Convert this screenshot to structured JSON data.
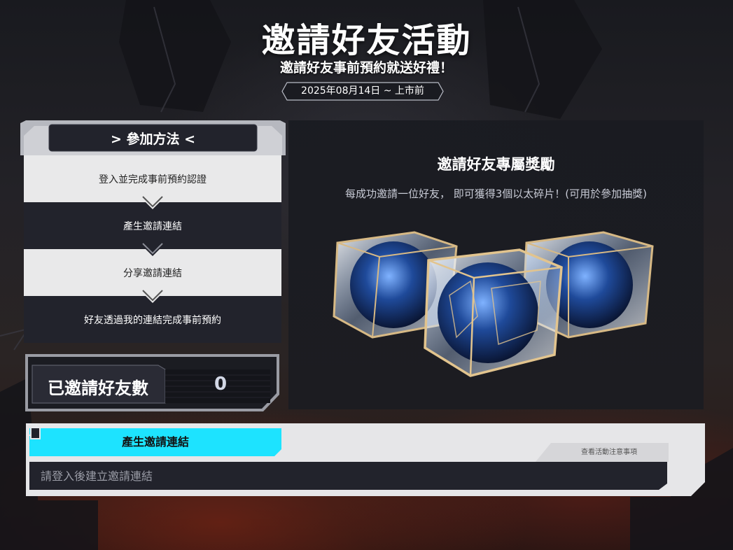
{
  "header": {
    "title": "邀請好友活動",
    "subtitle": "邀請好友事前預約就送好禮！",
    "date": "2025年08月14日 ~ 上市前"
  },
  "steps": {
    "title": "參加方法",
    "items": [
      {
        "label": "登入並完成事前預約認證"
      },
      {
        "label": "產生邀請連結"
      },
      {
        "label": "分享邀請連結"
      },
      {
        "label": "好友透過我的連結完成事前預約"
      }
    ]
  },
  "invite_count": {
    "label": "已邀請好友數",
    "value": "0"
  },
  "reward": {
    "title": "邀請好友專屬獎勵",
    "description": "每成功邀請一位好友， 即可獲得3個以太碎片！(可用於參加抽獎)",
    "item_icon": "ether-shard-cube-icon"
  },
  "link_section": {
    "generate_button": "產生邀請連結",
    "notice_link": "查看活動注意事項",
    "input_placeholder": "請登入後建立邀請連結",
    "copy_icon": "copy-icon"
  },
  "colors": {
    "accent": "#1de3ff",
    "panel_dark": "#22232c",
    "panel_light": "#e9e9ea"
  }
}
